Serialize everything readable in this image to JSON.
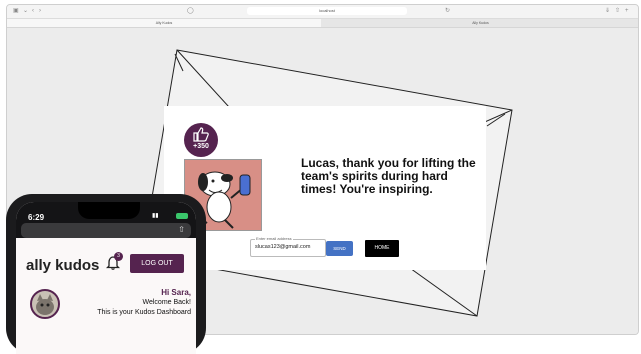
{
  "browser": {
    "url": "localhost",
    "tabs": [
      "Ally Kudos",
      "Ally Kudos"
    ]
  },
  "kudos_card": {
    "points": "+350",
    "message": "Lucas, thank you for lifting the team's spirits during hard times! You're inspiring.",
    "email_label": "Enter email address",
    "email_value": "slucas123@gmail.com",
    "send_label": "SEND",
    "home_label": "HOME"
  },
  "phone": {
    "time": "6:29",
    "brand": "ally kudos",
    "notification_count": "3",
    "logout_label": "LOG OUT",
    "greeting": "Hi Sara,",
    "welcome": "Welcome Back!",
    "dashboard_text": "This is your Kudos Dashboard"
  },
  "colors": {
    "brand_purple": "#55234f",
    "send_blue": "#4472c4",
    "background": "#ececec"
  }
}
